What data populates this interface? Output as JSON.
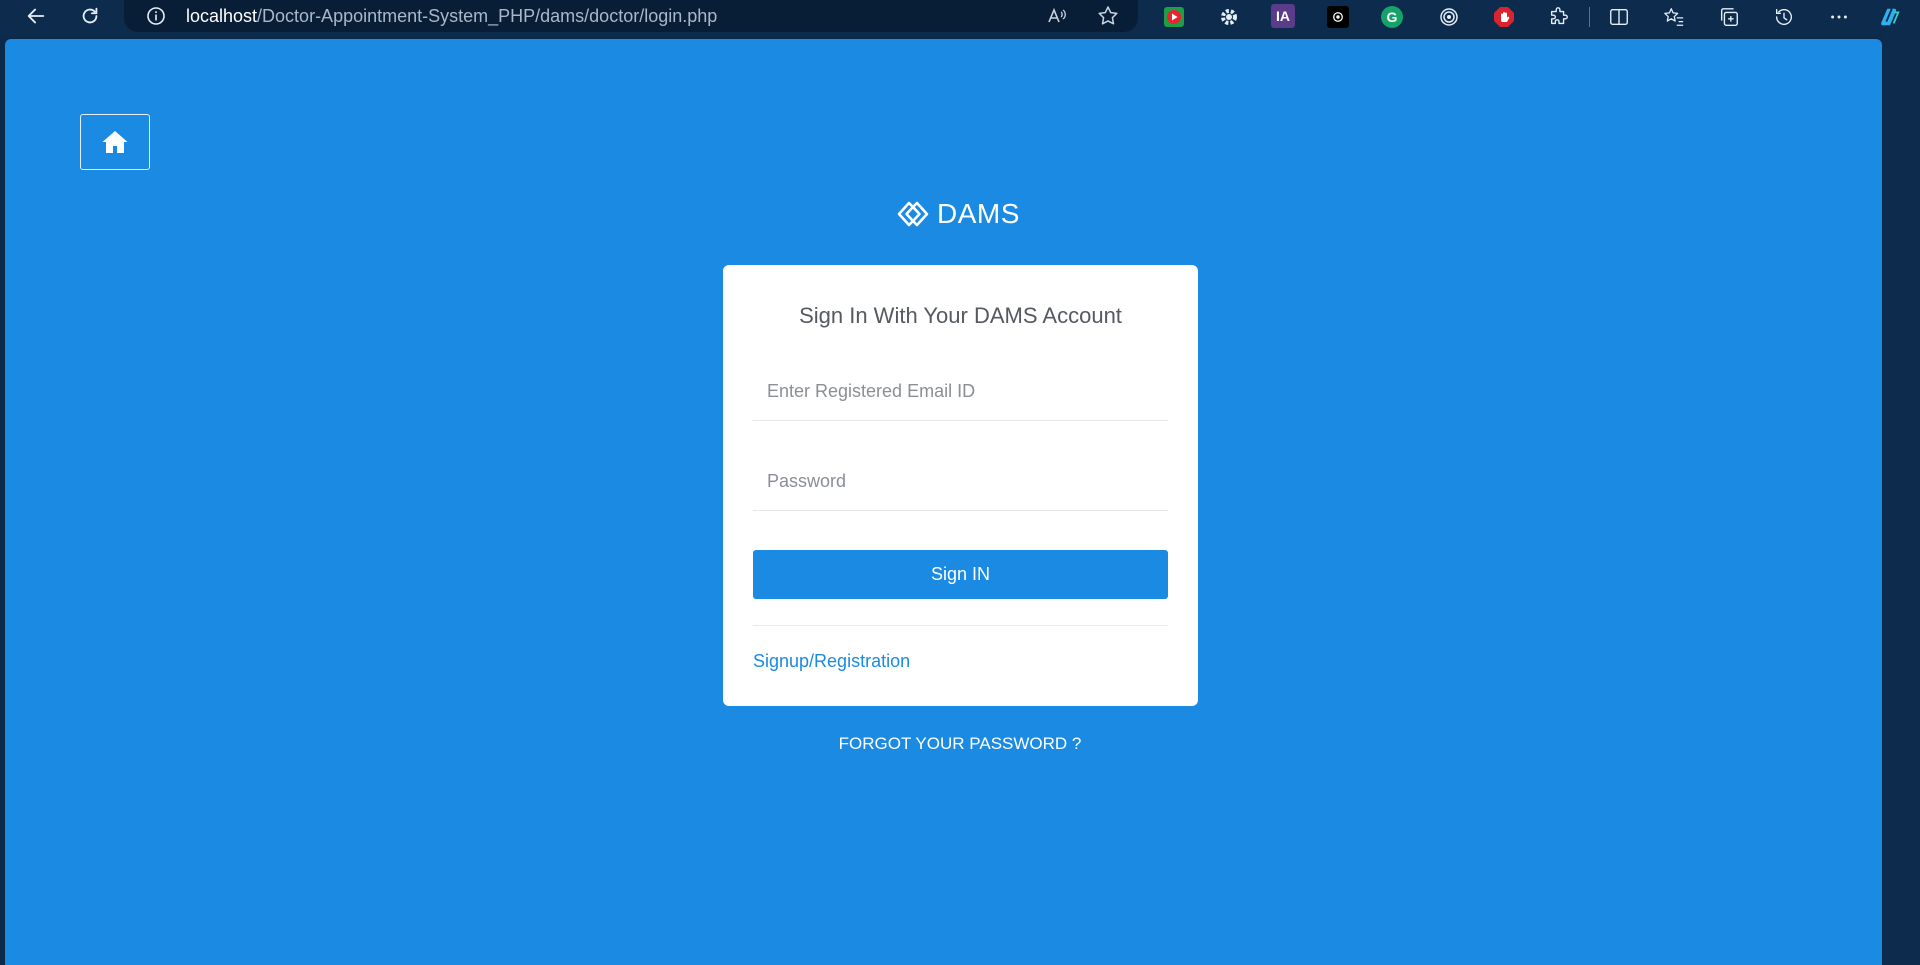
{
  "browser": {
    "url_host": "localhost",
    "url_path": "/Doctor-Appointment-System_PHP/dams/doctor/login.php",
    "extensions": [
      {
        "name": "video-extension-icon",
        "label": "",
        "bg": "#1e9e49",
        "fg": "#ffffff"
      },
      {
        "name": "settings-extension-icon",
        "label": "",
        "bg": "#0d2b4c",
        "fg": "#ffffff"
      },
      {
        "name": "ia-extension-icon",
        "label": "IA",
        "bg": "#5b3c8a",
        "fg": "#ffffff"
      },
      {
        "name": "dark-extension-icon",
        "label": "",
        "bg": "#000000",
        "fg": "#ffffff"
      },
      {
        "name": "grammarly-extension-icon",
        "label": "G",
        "bg": "#15a36a",
        "fg": "#ffffff"
      },
      {
        "name": "target-extension-icon",
        "label": "",
        "bg": "#0d2b4c",
        "fg": "#ffffff"
      },
      {
        "name": "adblock-extension-icon",
        "label": "",
        "bg": "#d9232e",
        "fg": "#ffffff"
      }
    ]
  },
  "page": {
    "brand": "DAMS",
    "card_title": "Sign In With Your DAMS Account",
    "email_placeholder": "Enter Registered Email ID",
    "password_placeholder": "Password",
    "signin_label": "Sign IN",
    "signup_label": "Signup/Registration",
    "forgot_label": "FORGOT YOUR PASSWORD ?"
  },
  "colors": {
    "accent": "#1b8ae2",
    "chrome": "#0d2b4c"
  }
}
